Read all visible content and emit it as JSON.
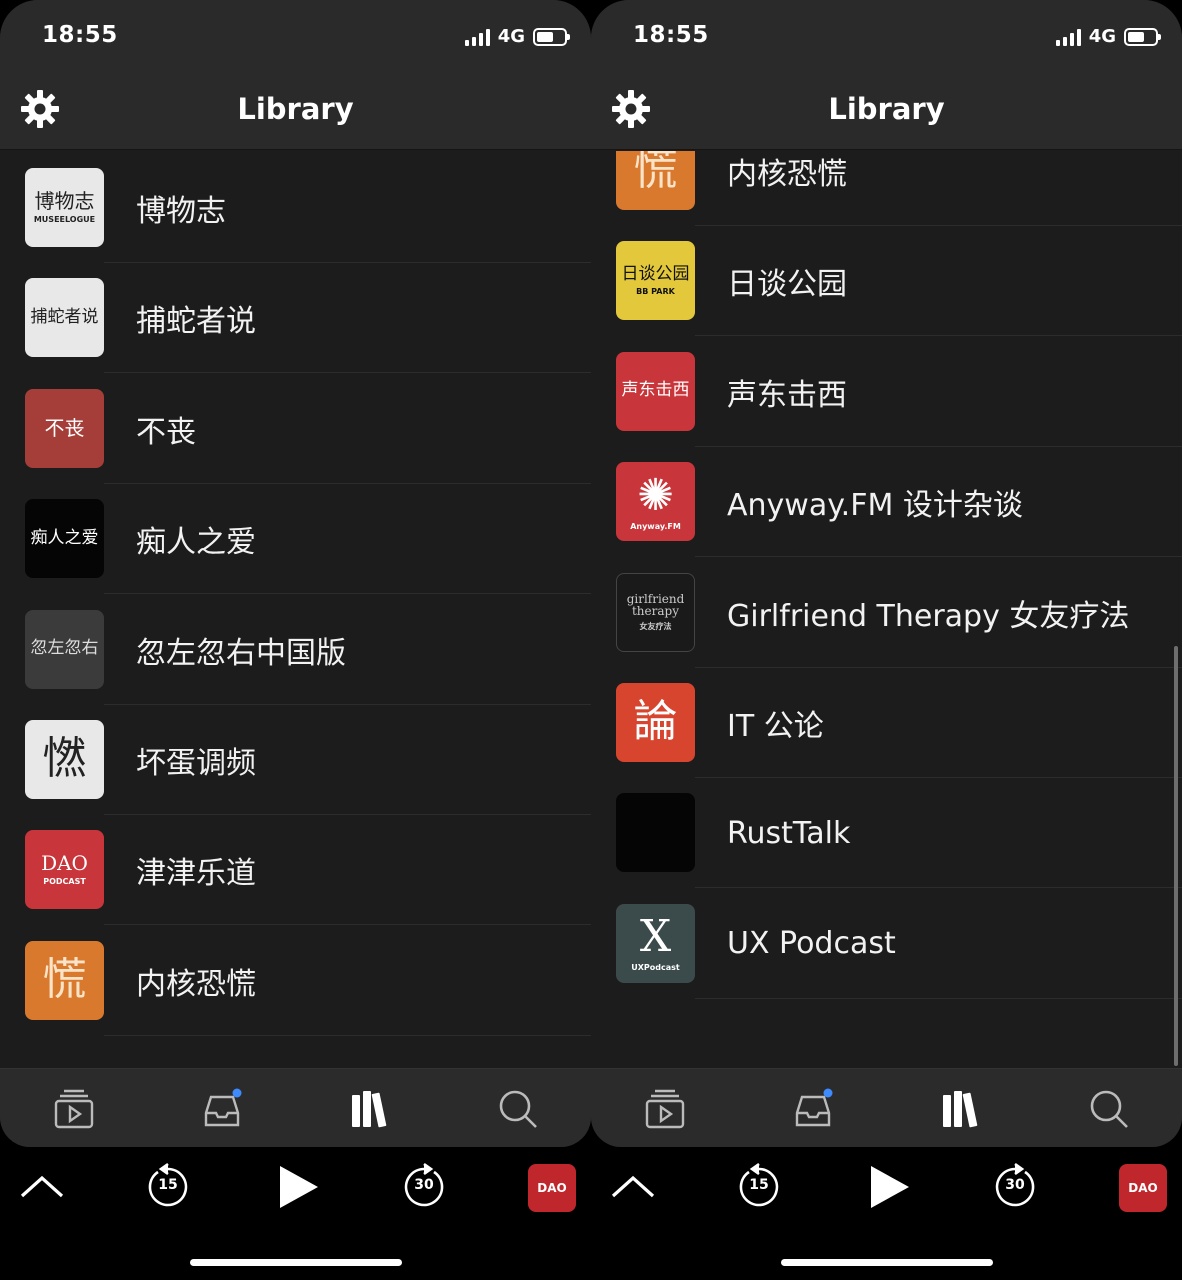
{
  "status": {
    "time": "18:55",
    "network": "4G"
  },
  "header": {
    "title": "Library"
  },
  "left_list": [
    {
      "name": "博物志",
      "art_text": "博物志",
      "art_sub": "MUSEELOGUE",
      "style": "a-light"
    },
    {
      "name": "捕蛇者说",
      "art_text": "捕蛇者说",
      "art_sub": "",
      "style": "a-light"
    },
    {
      "name": "不丧",
      "art_text": "不丧",
      "art_sub": "",
      "style": "a-red"
    },
    {
      "name": "痴人之爱",
      "art_text": "痴人之爱",
      "art_sub": "",
      "style": "a-black"
    },
    {
      "name": "忽左忽右中国版",
      "art_text": "忽左忽右",
      "art_sub": "",
      "style": "a-gray"
    },
    {
      "name": "坏蛋调频",
      "art_text": "㦓",
      "art_sub": "",
      "style": "a-light"
    },
    {
      "name": "津津乐道",
      "art_text": "DAO",
      "art_sub": "PODCAST",
      "style": "a-red2"
    },
    {
      "name": "内核恐慌",
      "art_text": "慌",
      "art_sub": "",
      "style": "a-orange"
    }
  ],
  "right_list": [
    {
      "name": "内核恐慌",
      "art_text": "慌",
      "art_sub": "",
      "style": "a-orange"
    },
    {
      "name": "日谈公园",
      "art_text": "日谈公园",
      "art_sub": "BB PARK",
      "style": "a-yellow"
    },
    {
      "name": "声东击西",
      "art_text": "声东击西",
      "art_sub": "",
      "style": "a-red2"
    },
    {
      "name": "Anyway.FM 设计杂谈",
      "art_text": "✺",
      "art_sub": "Anyway.FM",
      "style": "a-red2"
    },
    {
      "name": "Girlfriend Therapy 女友疗法",
      "art_text": "girlfriend therapy",
      "art_sub": "女友疗法",
      "style": "a-dark"
    },
    {
      "name": "IT 公论",
      "art_text": "論",
      "art_sub": "",
      "style": "a-orred"
    },
    {
      "name": "RustTalk",
      "art_text": "",
      "art_sub": "",
      "style": "a-black"
    },
    {
      "name": "UX Podcast",
      "art_text": "X",
      "art_sub": "UXPodcast",
      "style": "a-teal"
    }
  ],
  "player": {
    "skip_back": "15",
    "skip_forward": "30",
    "mini_art_text": "DAO"
  },
  "colors": {
    "accent_dot": "#3d8bff",
    "background": "#1c1c1c",
    "bar": "#2a2a2a"
  }
}
